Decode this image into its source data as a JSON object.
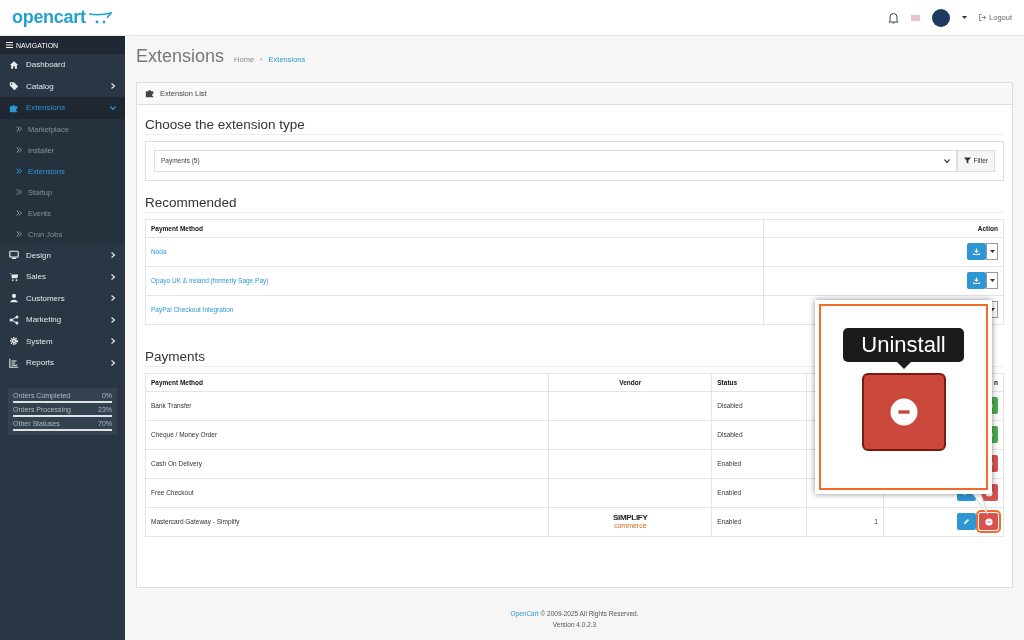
{
  "header": {
    "logo": "opencart",
    "logout": "Logout"
  },
  "sidebar": {
    "title": "NAVIGATION",
    "items": [
      {
        "label": "Dashboard",
        "kind": "link",
        "selected": false
      },
      {
        "label": "Catalog",
        "kind": "group",
        "selected": false,
        "expanded": false
      },
      {
        "label": "Extensions",
        "kind": "group",
        "selected": true,
        "expanded": true,
        "children": [
          {
            "label": "Marketplace",
            "selected": false
          },
          {
            "label": "Installer",
            "selected": false
          },
          {
            "label": "Extensions",
            "selected": true
          },
          {
            "label": "Startup",
            "selected": false
          },
          {
            "label": "Events",
            "selected": false
          },
          {
            "label": "Cron Jobs",
            "selected": false
          }
        ]
      },
      {
        "label": "Design",
        "kind": "group",
        "selected": false,
        "expanded": false
      },
      {
        "label": "Sales",
        "kind": "group",
        "selected": false,
        "expanded": false
      },
      {
        "label": "Customers",
        "kind": "group",
        "selected": false,
        "expanded": false
      },
      {
        "label": "Marketing",
        "kind": "group",
        "selected": false,
        "expanded": false
      },
      {
        "label": "System",
        "kind": "group",
        "selected": false,
        "expanded": false
      },
      {
        "label": "Reports",
        "kind": "group",
        "selected": false,
        "expanded": false
      }
    ],
    "stats": [
      {
        "label": "Orders Completed",
        "value": "0%"
      },
      {
        "label": "Orders Processing",
        "value": "23%"
      },
      {
        "label": "Other Statuses",
        "value": "70%"
      }
    ]
  },
  "page": {
    "title": "Extensions",
    "breadcrumbs": [
      "Home",
      "Extensions"
    ],
    "breadcrumb_separator": "›"
  },
  "panel": {
    "title": "Extension List",
    "type_heading": "Choose the extension type",
    "select_value": "Payments (5)",
    "filter_button": "Filter"
  },
  "recommended": {
    "heading": "Recommended",
    "columns": [
      "Payment Method",
      "Action"
    ],
    "rows": [
      {
        "name": "Noda",
        "kind": "full"
      },
      {
        "name": "Opayo UK & Ireland (formerly Sage Pay)",
        "kind": "full"
      },
      {
        "name": "PayPal Checkout Integration",
        "kind": "partial"
      }
    ]
  },
  "payments": {
    "heading": "Payments",
    "columns": [
      "Payment Method",
      "Vendor",
      "Status",
      "",
      "n"
    ],
    "rows": [
      {
        "name": "Bank Transfer",
        "status": "Disabled",
        "installed": false
      },
      {
        "name": "Cheque / Money Order",
        "status": "Disabled",
        "installed": false
      },
      {
        "name": "Cash On Delivery",
        "status": "Enabled",
        "installed": true
      },
      {
        "name": "Free Checkout",
        "status": "Enabled",
        "installed": true
      },
      {
        "name": "Mastercard Gateway - Simplify",
        "vendor_logo": {
          "title": "SIMPLIFY",
          "subtitle": "commerce"
        },
        "status": "Enabled",
        "sort_order": "1",
        "installed": true,
        "highlighted": true
      }
    ]
  },
  "callout": {
    "tooltip": "Uninstall"
  },
  "footer": {
    "link": "OpenCart",
    "text": " © 2009-2025 All Rights Reserved.",
    "version": "Version 4.0.2.3"
  }
}
